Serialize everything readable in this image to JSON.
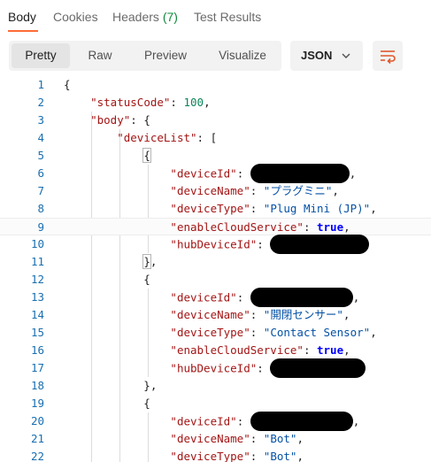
{
  "tabs": {
    "body": "Body",
    "cookies": "Cookies",
    "headers": "Headers",
    "headers_count": "(7)",
    "test_results": "Test Results"
  },
  "toolbar": {
    "pretty": "Pretty",
    "raw": "Raw",
    "preview": "Preview",
    "visualize": "Visualize",
    "format": "JSON"
  },
  "icons": {
    "format_dropdown": "chevron-down-icon",
    "wrap": "wrap-lines-icon"
  },
  "colors": {
    "accent": "#ff6c37",
    "json_key": "#a31515",
    "json_string": "#0451a5",
    "json_number": "#098658",
    "json_bool": "#0000ff",
    "line_number": "#1a6fb0"
  },
  "editor": {
    "line_numbers": [
      "1",
      "2",
      "3",
      "4",
      "5",
      "6",
      "7",
      "8",
      "9",
      "10",
      "11",
      "12",
      "13",
      "14",
      "15",
      "16",
      "17",
      "18",
      "19",
      "20",
      "21",
      "22"
    ],
    "key_status": "\"statusCode\"",
    "val_status": "100",
    "key_body": "\"body\"",
    "key_devicelist": "\"deviceList\"",
    "key_deviceid": "\"deviceId\"",
    "key_devicename": "\"deviceName\"",
    "key_devicetype": "\"deviceType\"",
    "key_cloud": "\"enableCloudService\"",
    "key_hub": "\"hubDeviceId\"",
    "val_true": "true",
    "devices": [
      {
        "name": "\"プラグミニ\"",
        "type": "\"Plug Mini (JP)\""
      },
      {
        "name": "\"開閉センサー\"",
        "type": "\"Contact Sensor\""
      },
      {
        "name": "\"Bot\"",
        "type": "\"Bot\""
      }
    ]
  }
}
